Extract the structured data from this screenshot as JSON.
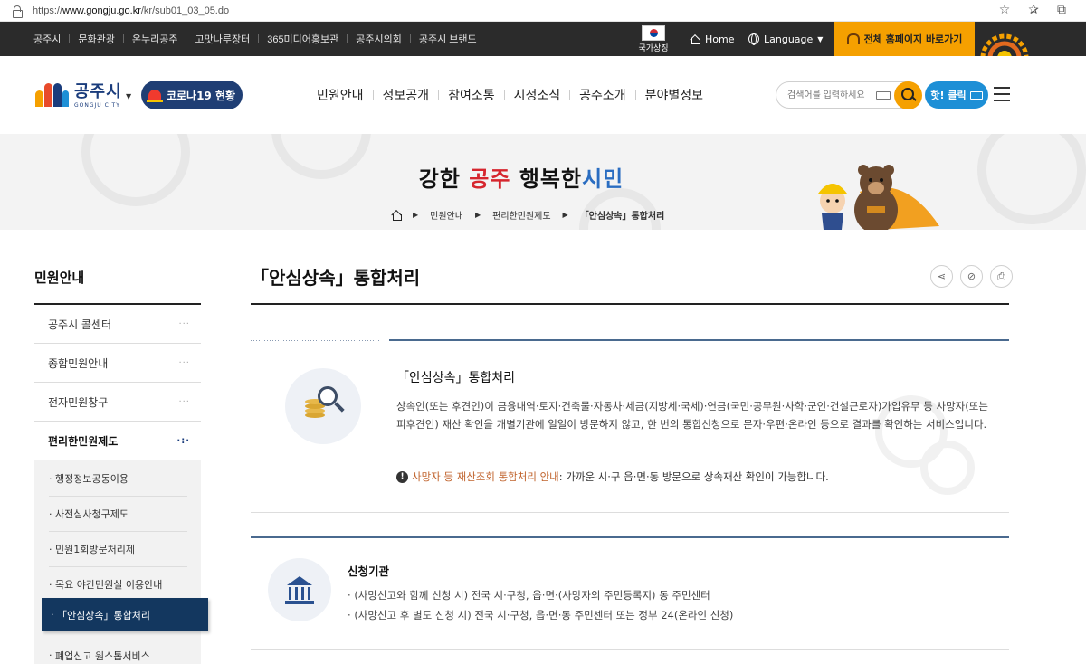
{
  "browser": {
    "url_prefix": "https://",
    "url_host": "www.gongju.go.kr",
    "url_path": "/kr/sub01_03_05.do"
  },
  "topbar": {
    "links": [
      "공주시",
      "문화관광",
      "온누리공주",
      "고맛나루장터",
      "365미디어홍보관",
      "공주시의회",
      "공주시 브랜드"
    ],
    "flag_label": "국가상징",
    "home_label": "Home",
    "language_label": "Language",
    "allsite_label": "전체 홈페이지 바로가기"
  },
  "header": {
    "logo_name": "공주시",
    "logo_sub": "GONGJU CITY",
    "covid_label": "코로나19 현황",
    "nav": [
      "민원안내",
      "정보공개",
      "참여소통",
      "시정소식",
      "공주소개",
      "분야별정보"
    ],
    "search_placeholder": "검색어를 입력하세요",
    "hot_label": "핫! 클릭"
  },
  "hero": {
    "slogan_1": "강한",
    "slogan_2": "공주",
    "slogan_3": "행복한",
    "slogan_4": "시민",
    "breadcrumb": [
      "민원안내",
      "편리한민원제도",
      "「안심상속」통합처리"
    ]
  },
  "sidebar": {
    "title": "민원안내",
    "items": [
      {
        "label": "공주시 콜센터",
        "dots": "···"
      },
      {
        "label": "종합민원안내",
        "dots": "···"
      },
      {
        "label": "전자민원창구",
        "dots": "···"
      },
      {
        "label": "편리한민원제도",
        "dots": "·:·"
      }
    ],
    "sub_items": [
      "행정정보공동이용",
      "사전심사청구제도",
      "민원1회방문처리제",
      "목요 야간민원실 이용안내",
      "「안심상속」통합처리",
      "폐업신고 원스톱서비스"
    ]
  },
  "content": {
    "title": "「안심상속」통합처리",
    "box1": {
      "title": "「안심상속」통합처리",
      "desc": "상속인(또는 후견인)이 금융내역·토지·건축물·자동차·세금(지방세·국세)·연금(국민·공무원·사학·군인·건설근로자)가입유무 등 사망자(또는 피후견인) 재산 확인을 개별기관에 일일이 방문하지 않고, 한 번의 통합신청으로 문자·우편·온라인 등으로 결과를 확인하는 서비스입니다.",
      "note_highlight": "사망자 등 재산조회 통합처리 안내",
      "note_rest": " : 가까운 시·구 읍·면·동 방문으로 상속재산 확인이 가능합니다."
    },
    "box2": {
      "title": "신청기관",
      "items": [
        "(사망신고와 함께 신청 시) 전국 시·구청, 읍·면·(사망자의 주민등록지) 동 주민센터",
        "(사망신고 후 별도 신청 시) 전국 시·구청, 읍·면·동 주민센터 또는 정부 24(온라인 신청)"
      ]
    }
  }
}
